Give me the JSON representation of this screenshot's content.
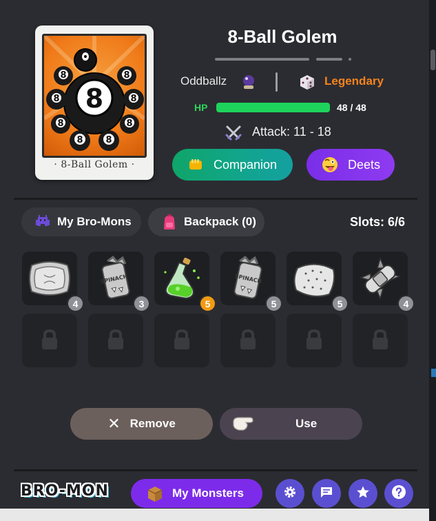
{
  "monster": {
    "name": "8-Ball Golem",
    "card_caption": "· 8-Ball Golem ·",
    "type": "Oddballz",
    "rarity": "Legendary",
    "hp_label": "HP",
    "hp_text": "48 / 48",
    "hp_fraction": 1.0,
    "attack_text": "Attack: 11 - 18"
  },
  "actions": {
    "companion_label": "Companion",
    "deets_label": "Deets"
  },
  "tabs": [
    {
      "label": "My Bro-Mons"
    },
    {
      "label": "Backpack (0)"
    }
  ],
  "slots_text": "Slots: 6/6",
  "items": [
    {
      "name": "pillow-icon",
      "count": "4"
    },
    {
      "name": "spinach-can-icon",
      "count": "3"
    },
    {
      "name": "green-potion-icon",
      "count": "5"
    },
    {
      "name": "spinach-can-icon",
      "count": "5"
    },
    {
      "name": "pillow-icon",
      "count": "5"
    },
    {
      "name": "bandage-icon",
      "count": "4"
    }
  ],
  "bottom_actions": {
    "remove_label": "Remove",
    "use_label": "Use"
  },
  "footer": {
    "logo": "BRO-MON",
    "my_monsters_label": "My Monsters"
  },
  "colors": {
    "rarity": "#f6831e",
    "hp": "#1ed35b",
    "companion": "#12a58e",
    "deets": "#8e3bf0",
    "footer_round": "#5b4fd1"
  }
}
